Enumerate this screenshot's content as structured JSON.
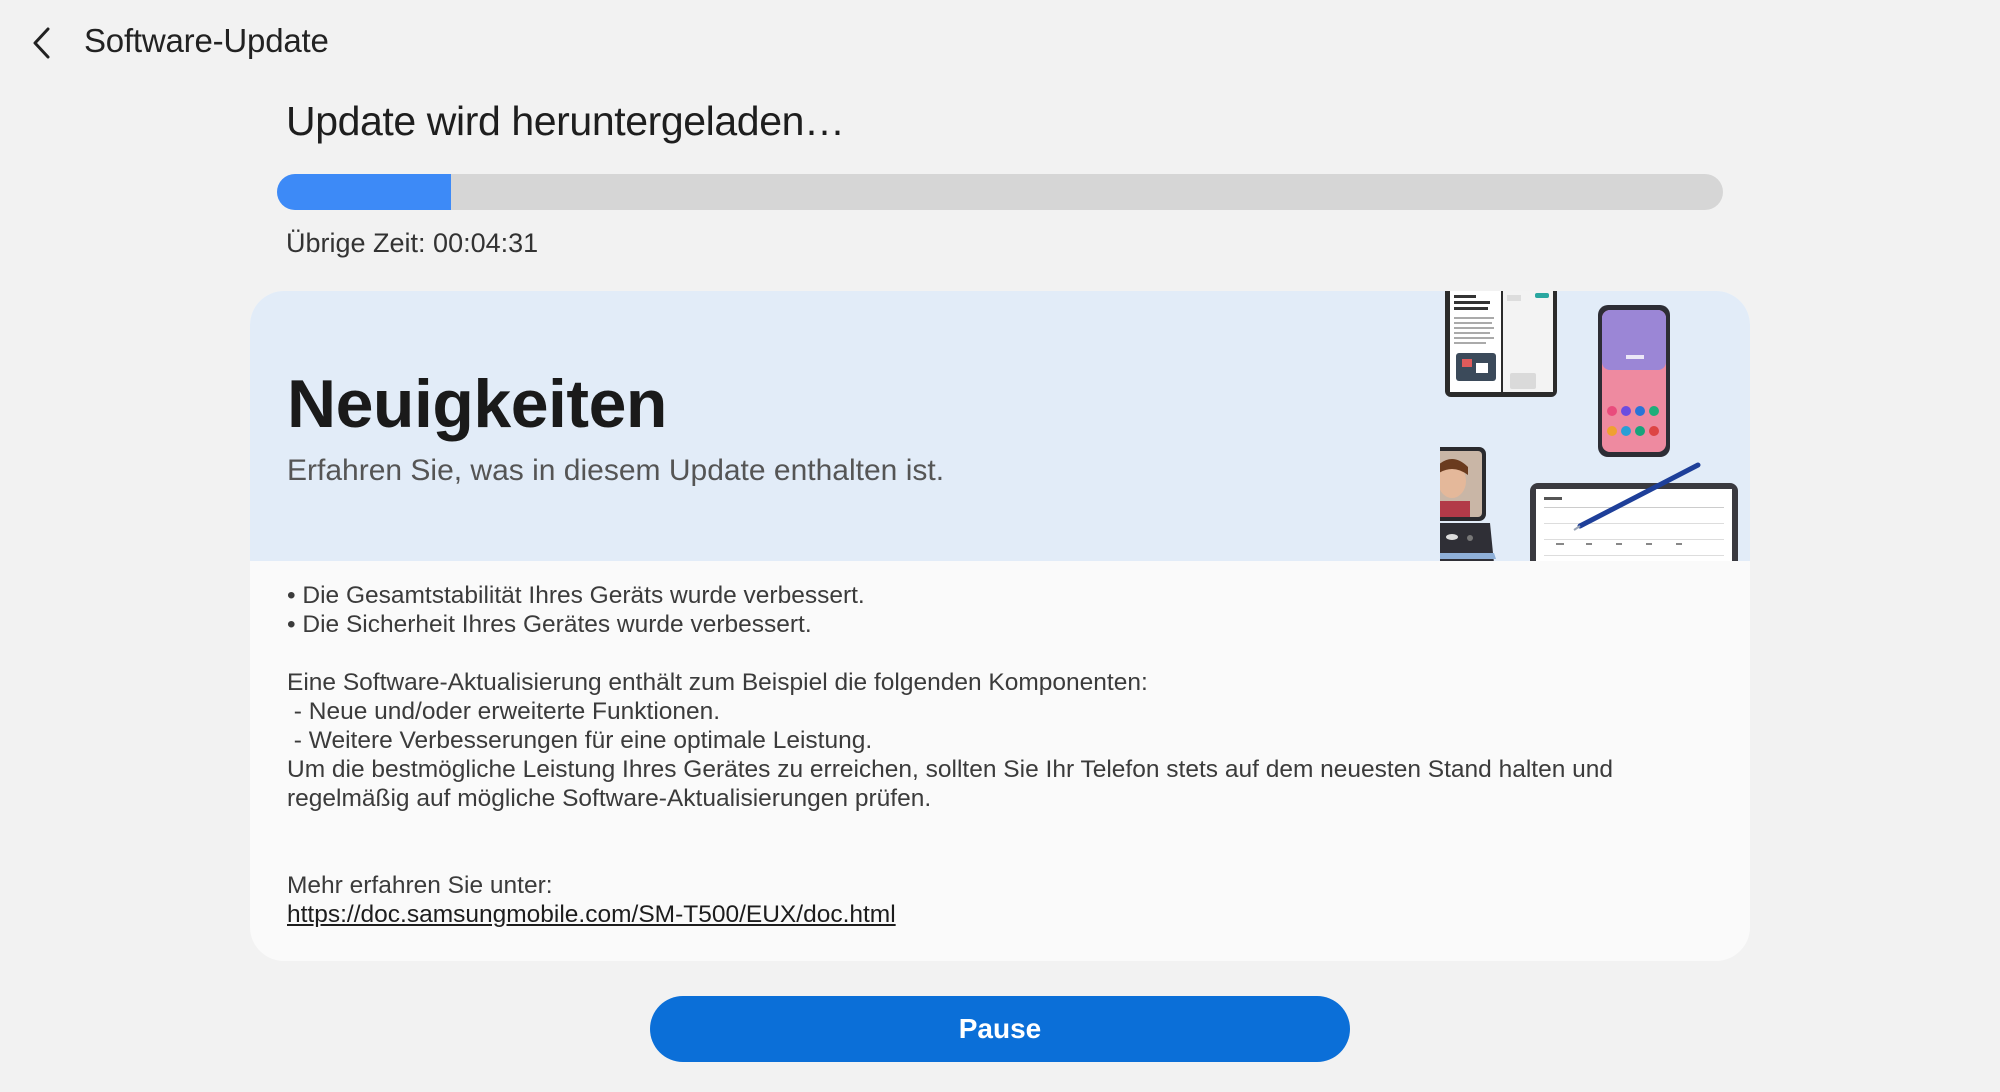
{
  "header": {
    "back_icon": "chevron-left-icon",
    "title": "Software-Update"
  },
  "status": {
    "title": "Update wird heruntergeladen…",
    "progress_fraction": 0.12,
    "progress_color": "#3d8af7",
    "remaining_time": "Übrige Zeit: 00:04:31"
  },
  "whats_new": {
    "title": "Neuigkeiten",
    "subtitle": "Erfahren Sie, was in diesem Update enthalten ist.",
    "illustration": "devices-illustration",
    "lines": [
      "• Die Gesamtstabilität Ihres Geräts wurde verbessert.",
      "• Die Sicherheit Ihres Gerätes wurde verbessert.",
      "",
      "Eine Software-Aktualisierung enthält zum Beispiel die folgenden Komponenten:",
      " - Neue und/oder erweiterte Funktionen.",
      " - Weitere Verbesserungen für eine optimale Leistung.",
      "Um die bestmögliche Leistung Ihres Gerätes zu erreichen, sollten Sie Ihr Telefon stets auf dem neuesten Stand halten und",
      "regelmäßig auf mögliche Software-Aktualisierungen prüfen.",
      "",
      "",
      "Mehr erfahren Sie unter:"
    ],
    "link": "https://doc.samsungmobile.com/SM-T500/EUX/doc.html"
  },
  "actions": {
    "pause_label": "Pause",
    "accent": "#0b6fd8"
  }
}
